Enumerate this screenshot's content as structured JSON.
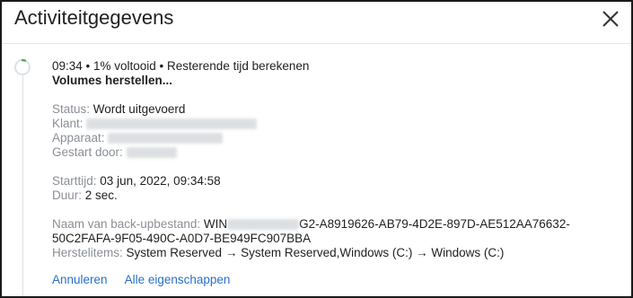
{
  "dialog": {
    "title": "Activiteitgegevens",
    "close_icon": "close-icon"
  },
  "activity": {
    "progress_fraction": 0.01,
    "summary_line": "09:34 • 1% voltooid • Resterende tijd berekenen",
    "operation": "Volumes herstellen...",
    "status_label": "Status:",
    "status_value": "Wordt uitgevoerd",
    "client_label": "Klant:",
    "device_label": "Apparaat:",
    "started_by_label": "Gestart door:",
    "start_time_label": "Starttijd:",
    "start_time_value": "03 jun, 2022, 09:34:58",
    "duration_label": "Duur:",
    "duration_value": "2 sec.",
    "backup_file_label": "Naam van back-upbestand:",
    "backup_file_prefix": "WIN",
    "backup_file_suffix": "G2-A8919626-AB79-4D2E-897D-AE512AA76632-",
    "backup_file_line2": "50C2FAFA-9F05-490C-A0D7-BE949FC907BBA",
    "recovery_items_label": "Herstelitems:",
    "recovery_items_value": "System Reserved → System Reserved,Windows (C:) → Windows (C:)"
  },
  "actions": {
    "cancel_label": "Annuleren",
    "all_properties_label": "Alle eigenschappen"
  },
  "colors": {
    "accent": "#2a6fc9",
    "progress": "#4caf50",
    "muted": "#8a8f96"
  }
}
